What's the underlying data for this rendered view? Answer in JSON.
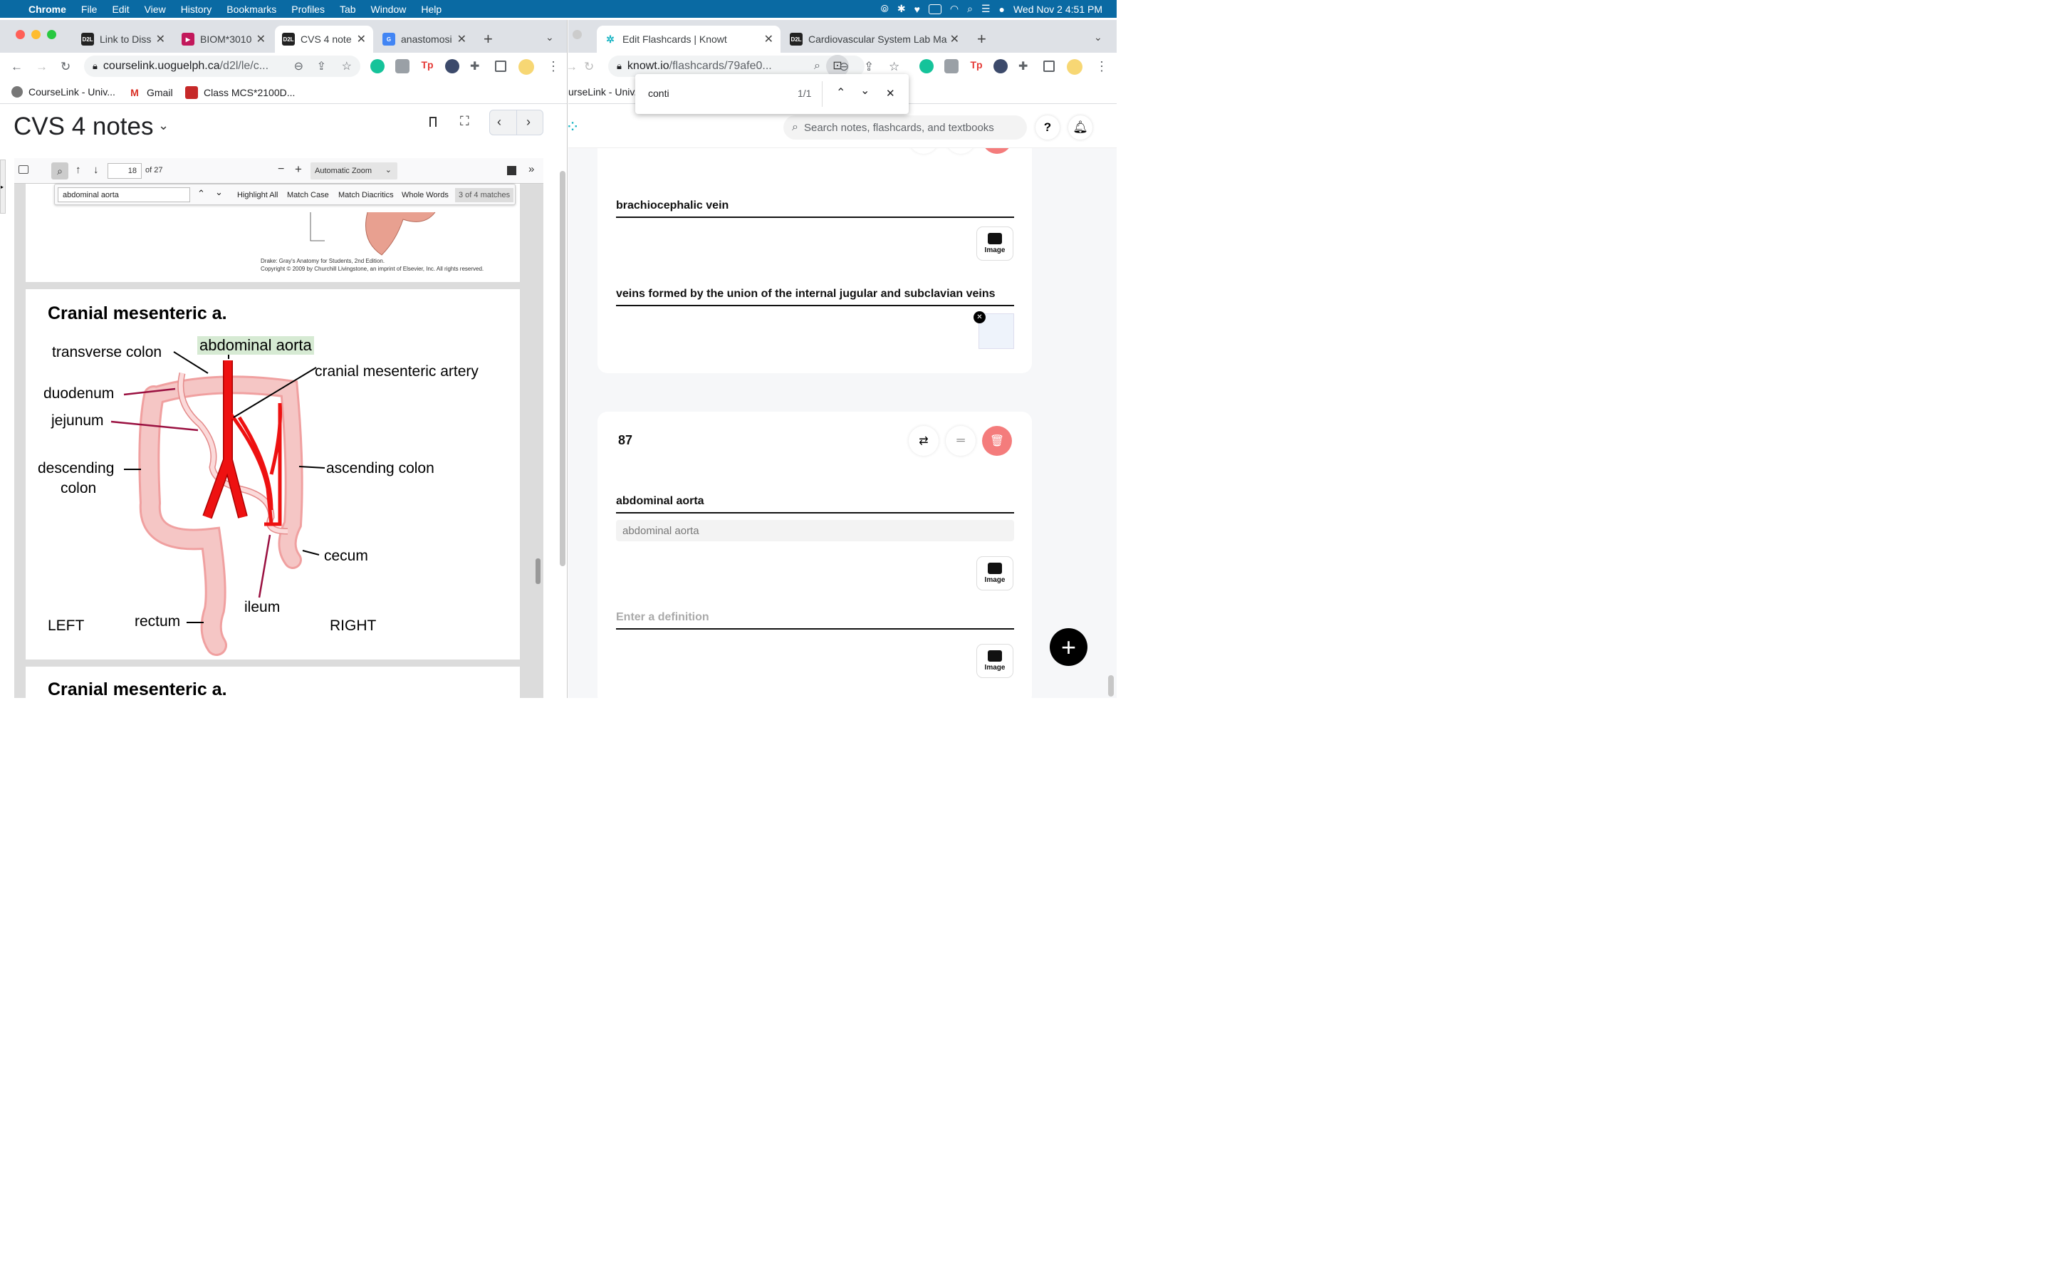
{
  "menubar": {
    "app": "Chrome",
    "items": [
      "File",
      "Edit",
      "View",
      "History",
      "Bookmarks",
      "Profiles",
      "Tab",
      "Window",
      "Help"
    ],
    "datetime": "Wed Nov 2  4:51 PM"
  },
  "left": {
    "tabs": [
      {
        "label": "Link to Diss"
      },
      {
        "label": "BIOM*3010"
      },
      {
        "label": "CVS 4 note"
      },
      {
        "label": "anastomosi"
      }
    ],
    "url_host": "courselink.uoguelph.ca",
    "url_path": "/d2l/le/c...",
    "bookmarks": [
      "CourseLink - Univ...",
      "Gmail",
      "Class MCS*2100D..."
    ],
    "title": "CVS 4 notes",
    "pdf": {
      "page": "18",
      "of": "of 27",
      "zoom": "Automatic Zoom",
      "find_query": "abdominal aorta",
      "highlight_all": "Highlight All",
      "match_case": "Match Case",
      "match_diacritics": "Match Diacritics",
      "whole_words": "Whole Words",
      "matches": "3 of 4 matches",
      "caption1": "Drake: Gray's Anatomy for Students, 2nd Edition.",
      "caption2": "Copyright © 2009 by Churchill Livingstone, an imprint of Elsevier, Inc. All rights reserved.",
      "slide_title": "Cranial mesenteric a.",
      "slide_title2": "Cranial mesenteric a.",
      "labels": {
        "abdominal_aorta": "abdominal aorta",
        "transverse_colon": "transverse colon",
        "cranial_mesenteric_artery": "cranial mesenteric artery",
        "duodenum": "duodenum",
        "jejunum": "jejunum",
        "descending": "descending",
        "colon": "colon",
        "ascending_colon": "ascending colon",
        "cecum": "cecum",
        "ileum": "ileum",
        "rectum": "rectum",
        "left": "LEFT",
        "right": "RIGHT"
      }
    }
  },
  "right": {
    "tabs": [
      {
        "label": "Edit Flashcards | Knowt"
      },
      {
        "label": "Cardiovascular System Lab Ma"
      }
    ],
    "url_host": "knowt.io",
    "url_path": "/flashcards/79afe0...",
    "bookmark_fragment": "urseLink - Univ...",
    "find": {
      "query": "conti",
      "count": "1/1"
    },
    "search_placeholder": "Search notes, flashcards, and textbooks",
    "card1": {
      "term": "brachiocephalic vein",
      "definition": "veins formed by the union of the internal jugular and subclavian veins",
      "image_label": "Image"
    },
    "card2": {
      "number": "87",
      "term": "abdominal aorta",
      "suggestion": "abdominal aorta",
      "def_placeholder": "Enter a definition",
      "image_label": "Image",
      "image_label2": "Image"
    }
  },
  "colors": {
    "menubar": "#0a6aa3",
    "highlight": "#d6ead3",
    "delete": "#f47c7c",
    "artery": "#ee1111",
    "intestine": "#f5c0bf"
  }
}
